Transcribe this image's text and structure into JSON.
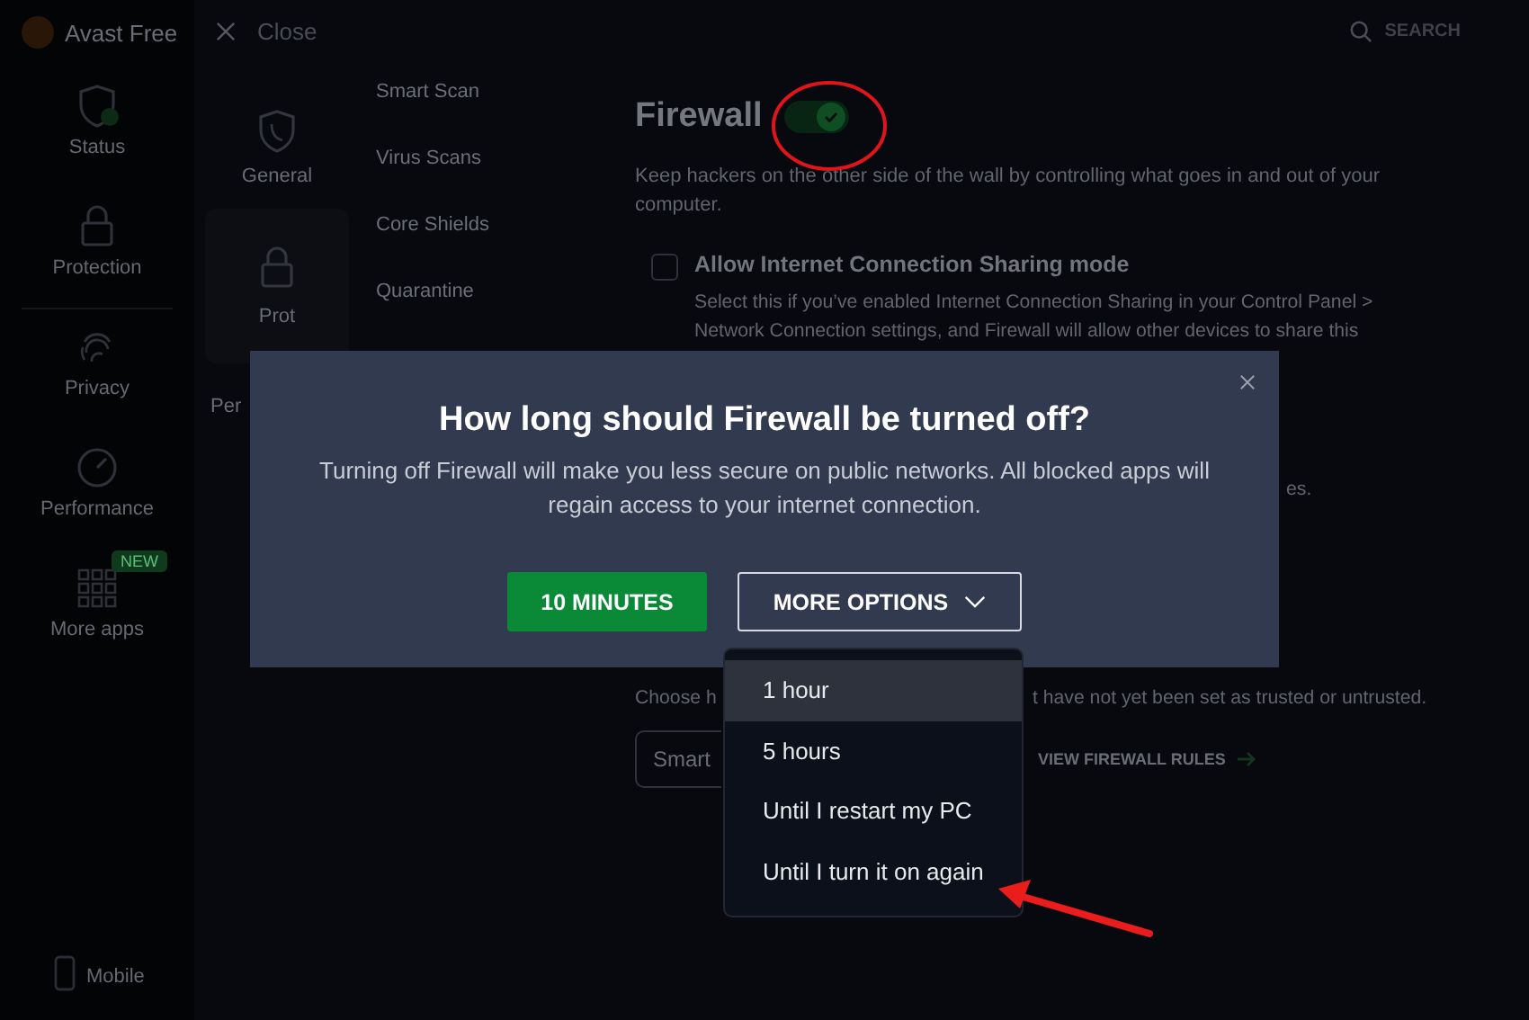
{
  "app": {
    "title": "Avast Free"
  },
  "nav": [
    {
      "label": "Status",
      "kind": "status"
    },
    {
      "label": "Protection",
      "kind": "protection"
    },
    {
      "label": "Privacy",
      "kind": "privacy"
    },
    {
      "label": "Performance",
      "kind": "performance"
    },
    {
      "label": "More apps",
      "kind": "apps",
      "badge": "NEW"
    }
  ],
  "mobile": {
    "label": "Mobile"
  },
  "close": {
    "label": "Close"
  },
  "search": {
    "label": "SEARCH"
  },
  "categories": [
    {
      "label": "General",
      "kind": "shield",
      "selected": false
    },
    {
      "label": "Prot",
      "kind": "lock",
      "selected": true
    },
    {
      "label": "Per",
      "kind": "none",
      "selected": false
    }
  ],
  "subnav": [
    "Smart Scan",
    "Virus Scans",
    "Core Shields",
    "Quarantine"
  ],
  "firewall": {
    "title": "Firewall",
    "on": true,
    "description_lines": [
      "Keep hackers on the other side of the wall by controlling what goes in and out of your",
      "computer."
    ],
    "sharing": {
      "label": "Allow Internet Connection Sharing mode",
      "checked": false,
      "description_lines": [
        "Select this if you’ve enabled Internet Connection Sharing in your Control Panel >",
        "Network Connection settings, and Firewall will allow other devices to share this"
      ]
    },
    "fragment": "es.",
    "mode_text_left": "Choose h",
    "mode_text_right": "t have not yet been set as trusted or untrusted.",
    "mode_field": "Smart",
    "rules_link": "VIEW FIREWALL RULES"
  },
  "dialog": {
    "title": "How long should Firewall be turned off?",
    "message": "Turning off Firewall will make you less secure on public networks. All blocked apps will regain access to your internet connection.",
    "primary": "10 MINUTES",
    "secondary": "MORE OPTIONS",
    "menu": [
      {
        "label": "1 hour",
        "selected": true
      },
      {
        "label": "5 hours",
        "selected": false
      },
      {
        "label": "Until I restart my PC",
        "selected": false
      },
      {
        "label": "Until I turn it on again",
        "selected": false
      }
    ]
  },
  "annotations": [
    {
      "kind": "circle"
    },
    {
      "kind": "arrow"
    }
  ]
}
